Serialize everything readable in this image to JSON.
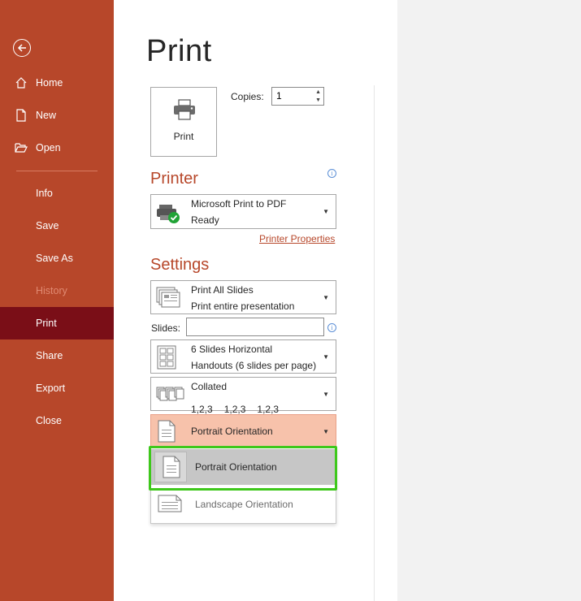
{
  "sidebar": {
    "items": [
      {
        "label": "Home"
      },
      {
        "label": "New"
      },
      {
        "label": "Open"
      },
      {
        "label": "Info"
      },
      {
        "label": "Save"
      },
      {
        "label": "Save As"
      },
      {
        "label": "History"
      },
      {
        "label": "Print"
      },
      {
        "label": "Share"
      },
      {
        "label": "Export"
      },
      {
        "label": "Close"
      }
    ]
  },
  "main": {
    "title": "Print",
    "print_button_label": "Print",
    "copies_label": "Copies:",
    "copies_value": "1",
    "printer_heading": "Printer",
    "printer_name": "Microsoft Print to PDF",
    "printer_status": "Ready",
    "printer_properties_link": "Printer Properties",
    "settings_heading": "Settings",
    "slides_scope": {
      "line1": "Print All Slides",
      "line2": "Print entire presentation"
    },
    "slides_label": "Slides:",
    "slides_value": "",
    "layout": {
      "line1": "6 Slides Horizontal",
      "line2": "Handouts (6 slides per page)"
    },
    "collation": {
      "line1": "Collated",
      "nums": [
        "1,2,3",
        "1,2,3",
        "1,2,3"
      ]
    },
    "orientation_selected": "Portrait Orientation",
    "orientation_options": [
      {
        "label": "Portrait Orientation"
      },
      {
        "label": "Landscape Orientation"
      }
    ]
  },
  "colors": {
    "accent": "#b7472a",
    "active_nav": "#7a0e17",
    "highlight": "#3ec81b"
  }
}
